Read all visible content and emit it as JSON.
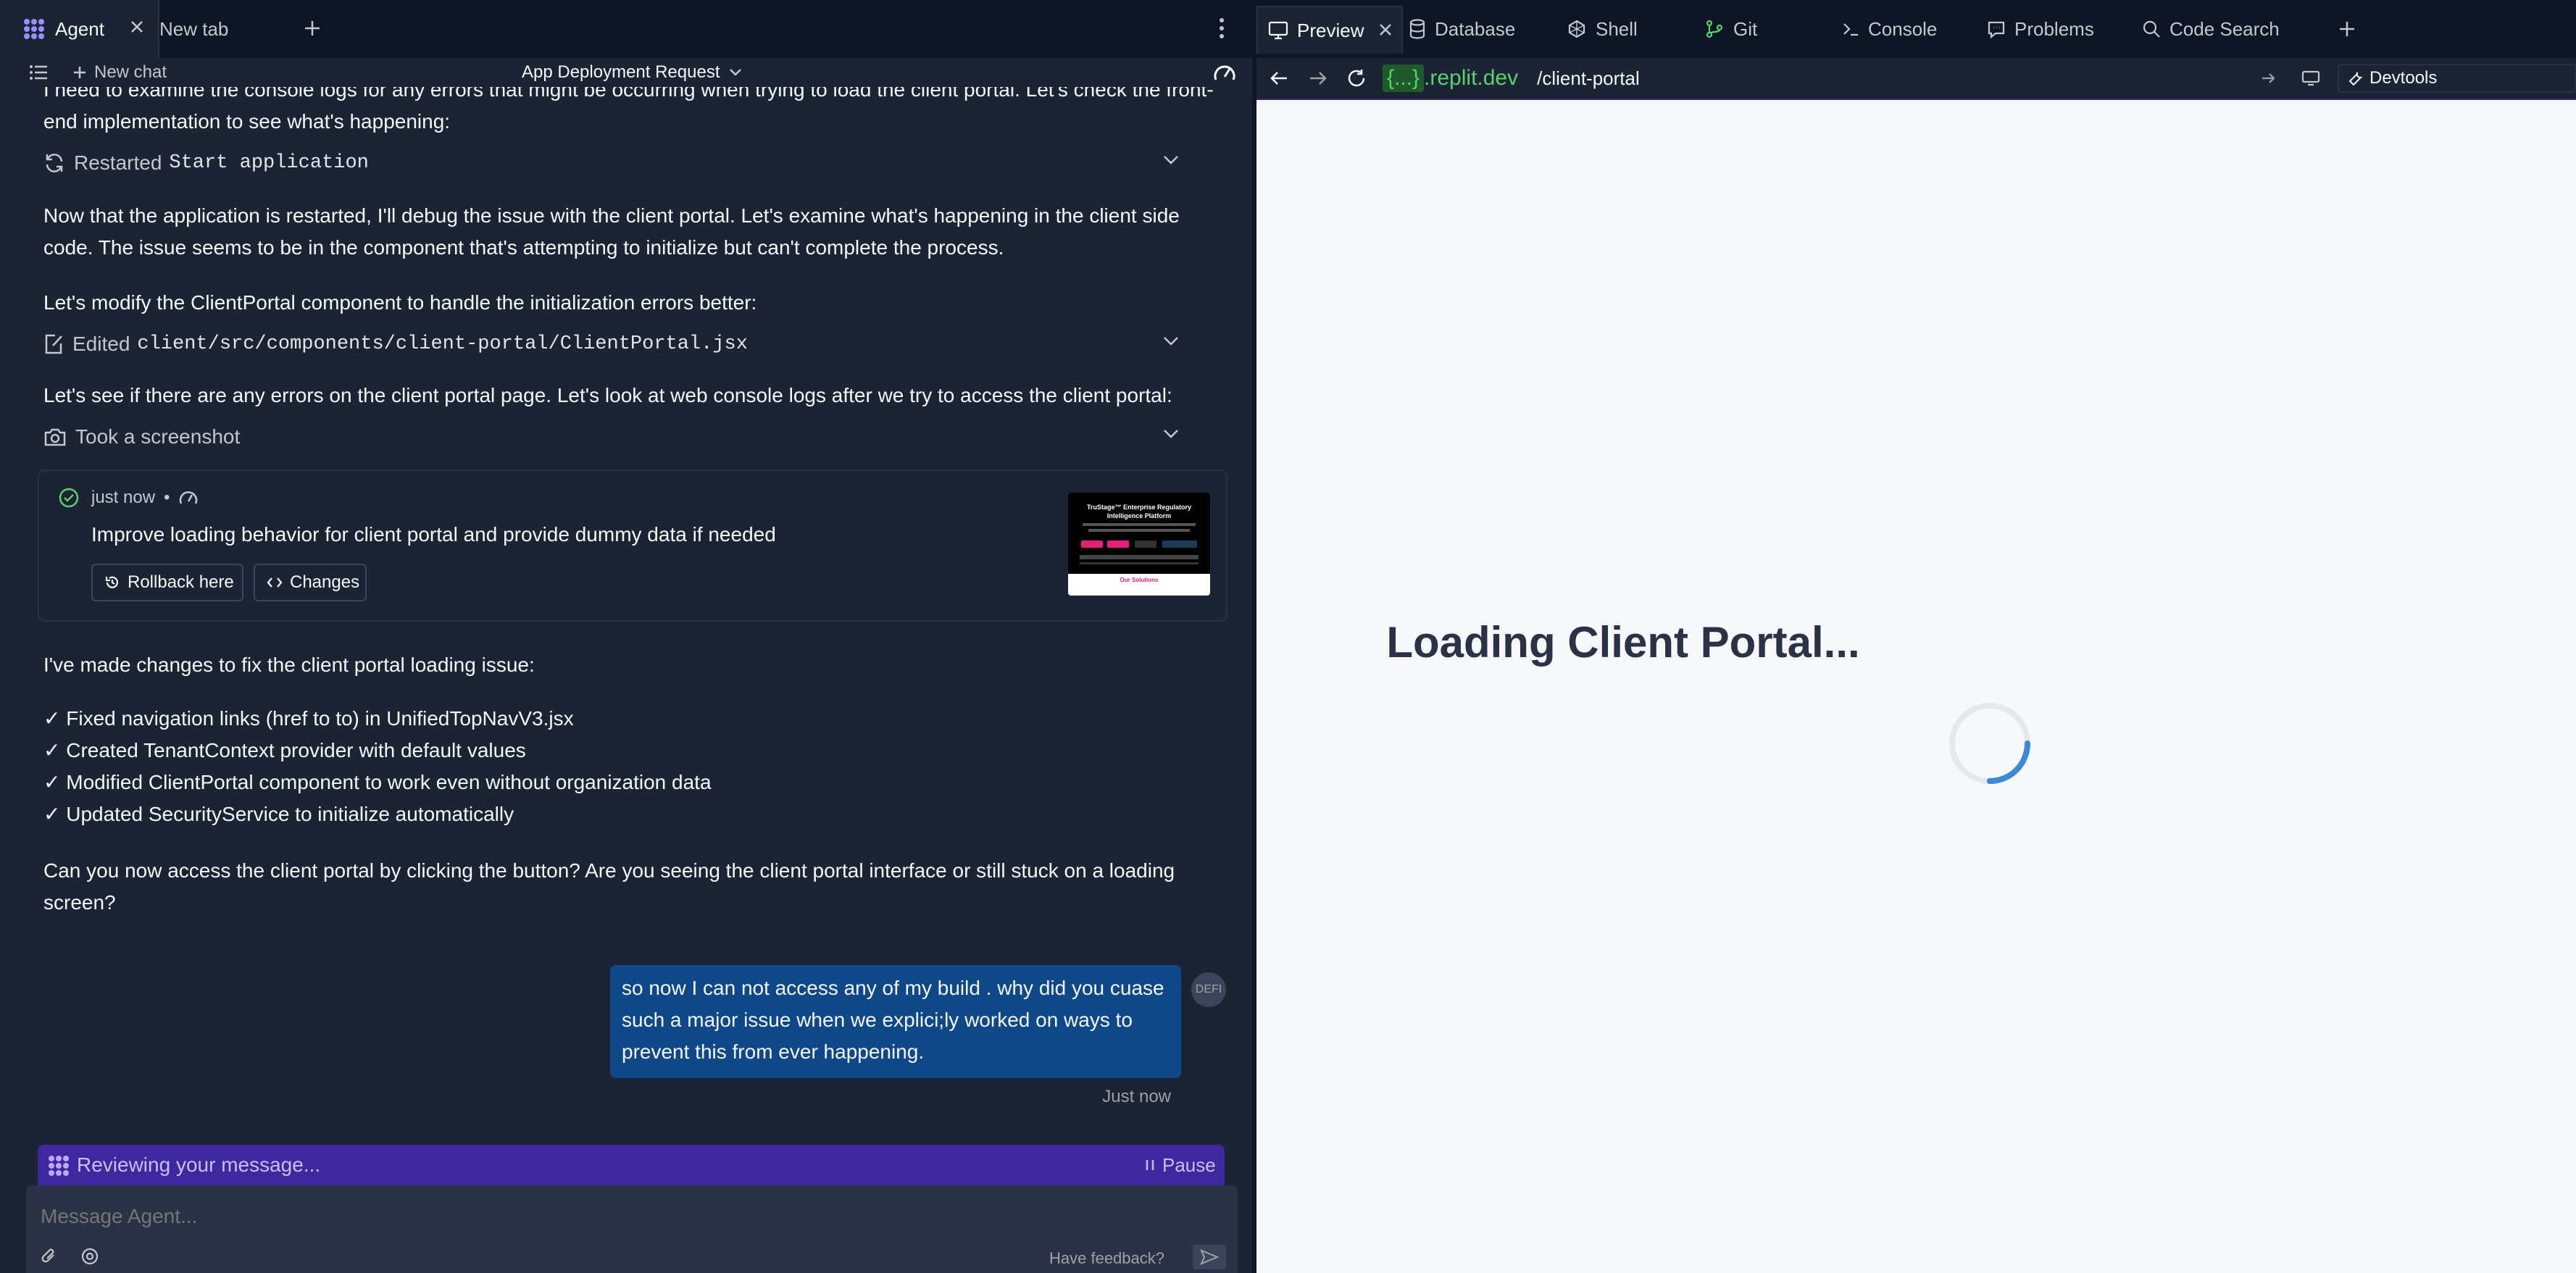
{
  "left_tabs": {
    "agent": "Agent",
    "new_tab": "New tab"
  },
  "subbar": {
    "new_chat": "New chat",
    "title": "App Deployment Request"
  },
  "chat": {
    "intro_cut": "I need to examine the console logs for any errors that might be occurring when trying to load the client portal. Let's check the front-",
    "intro_line2": "end implementation to see what's happening:",
    "tool1_label": "Restarted",
    "tool1_mono": "Start application",
    "p2_line1": "Now that the application is restarted, I'll debug the issue with the client portal. Let's examine what's happening in the client side",
    "p2_line2": "code. The issue seems to be in the component that's attempting to initialize but can't complete the process.",
    "p3": "Let's modify the ClientPortal component to handle the initialization errors better:",
    "tool2_label": "Edited",
    "tool2_mono": "client/src/components/client-portal/ClientPortal.jsx",
    "p4": "Let's see if there are any errors on the client portal page. Let's look at web console logs after we try to access the client portal:",
    "tool3_label": "Took a screenshot",
    "checkpoint": {
      "time": "just now",
      "sep": "•",
      "message": "Improve loading behavior for client portal and provide dummy data if needed",
      "rollback": "Rollback here",
      "changes": "Changes",
      "thumb_title": "TruStage™ Enterprise Regulatory Intelligence Platform",
      "thumb_cta": "Our Solutions"
    },
    "summary_intro": "I've made changes to fix the client portal loading issue:",
    "summary_items": [
      "✓ Fixed navigation links (href to to) in UnifiedTopNavV3.jsx",
      "✓ Created TenantContext provider with default values",
      "✓ Modified ClientPortal component to work even without organization data",
      "✓ Updated SecurityService to initialize automatically"
    ],
    "question_line1": "Can you now access the client portal by clicking the button? Are you seeing the client portal interface or still stuck on a loading",
    "question_line2": "screen?",
    "user_message": "so now I can not access any of my build . why did you cuase such a major issue when we explici;ly worked on ways to prevent this from ever happening.",
    "user_avatar": "DEFI",
    "user_time": "Just now"
  },
  "reviewing": {
    "text": "Reviewing your message...",
    "pause": "Pause"
  },
  "composer": {
    "placeholder": "Message Agent...",
    "feedback": "Have feedback?"
  },
  "right_tabs": [
    "Preview",
    "Database",
    "Shell",
    "Git",
    "Console",
    "Problems",
    "Code Search"
  ],
  "address": {
    "domain_badge": "{...}",
    "domain": ".replit.dev",
    "path": "/client-portal",
    "devtools": "Devtools"
  },
  "preview": {
    "loading_text": "Loading Client Portal..."
  },
  "colors": {
    "bg": "#1c2333",
    "accent": "#3d28a0",
    "user_bubble": "#0f4888",
    "spinner": "#3b8ad6",
    "domain_green": "#58d16f"
  }
}
